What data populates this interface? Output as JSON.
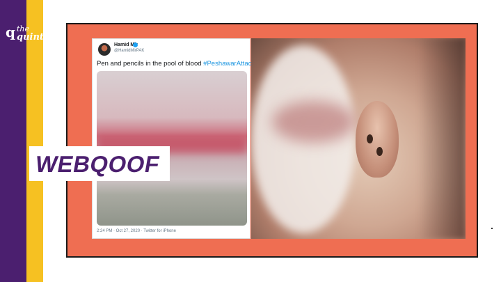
{
  "brand": {
    "logo_mark": "q",
    "logo_the": "the",
    "logo_quint": "quint",
    "purple": "#4b1f6f",
    "yellow": "#f6c122",
    "frame_color": "#ef6e52"
  },
  "tweet": {
    "author_name": "Hamid Mir",
    "author_handle": "@HamidMirPAK",
    "text": "Pen and pencils in the pool of blood ",
    "hashtag": "#PeshawarAttack",
    "timestamp": "2:24 PM · Oct 27, 2020 · Twitter for iPhone",
    "link_color": "#1b95e0"
  },
  "banner": {
    "text": "WEBQOOF"
  },
  "icons": [
    "verified-icon",
    "avatar"
  ]
}
